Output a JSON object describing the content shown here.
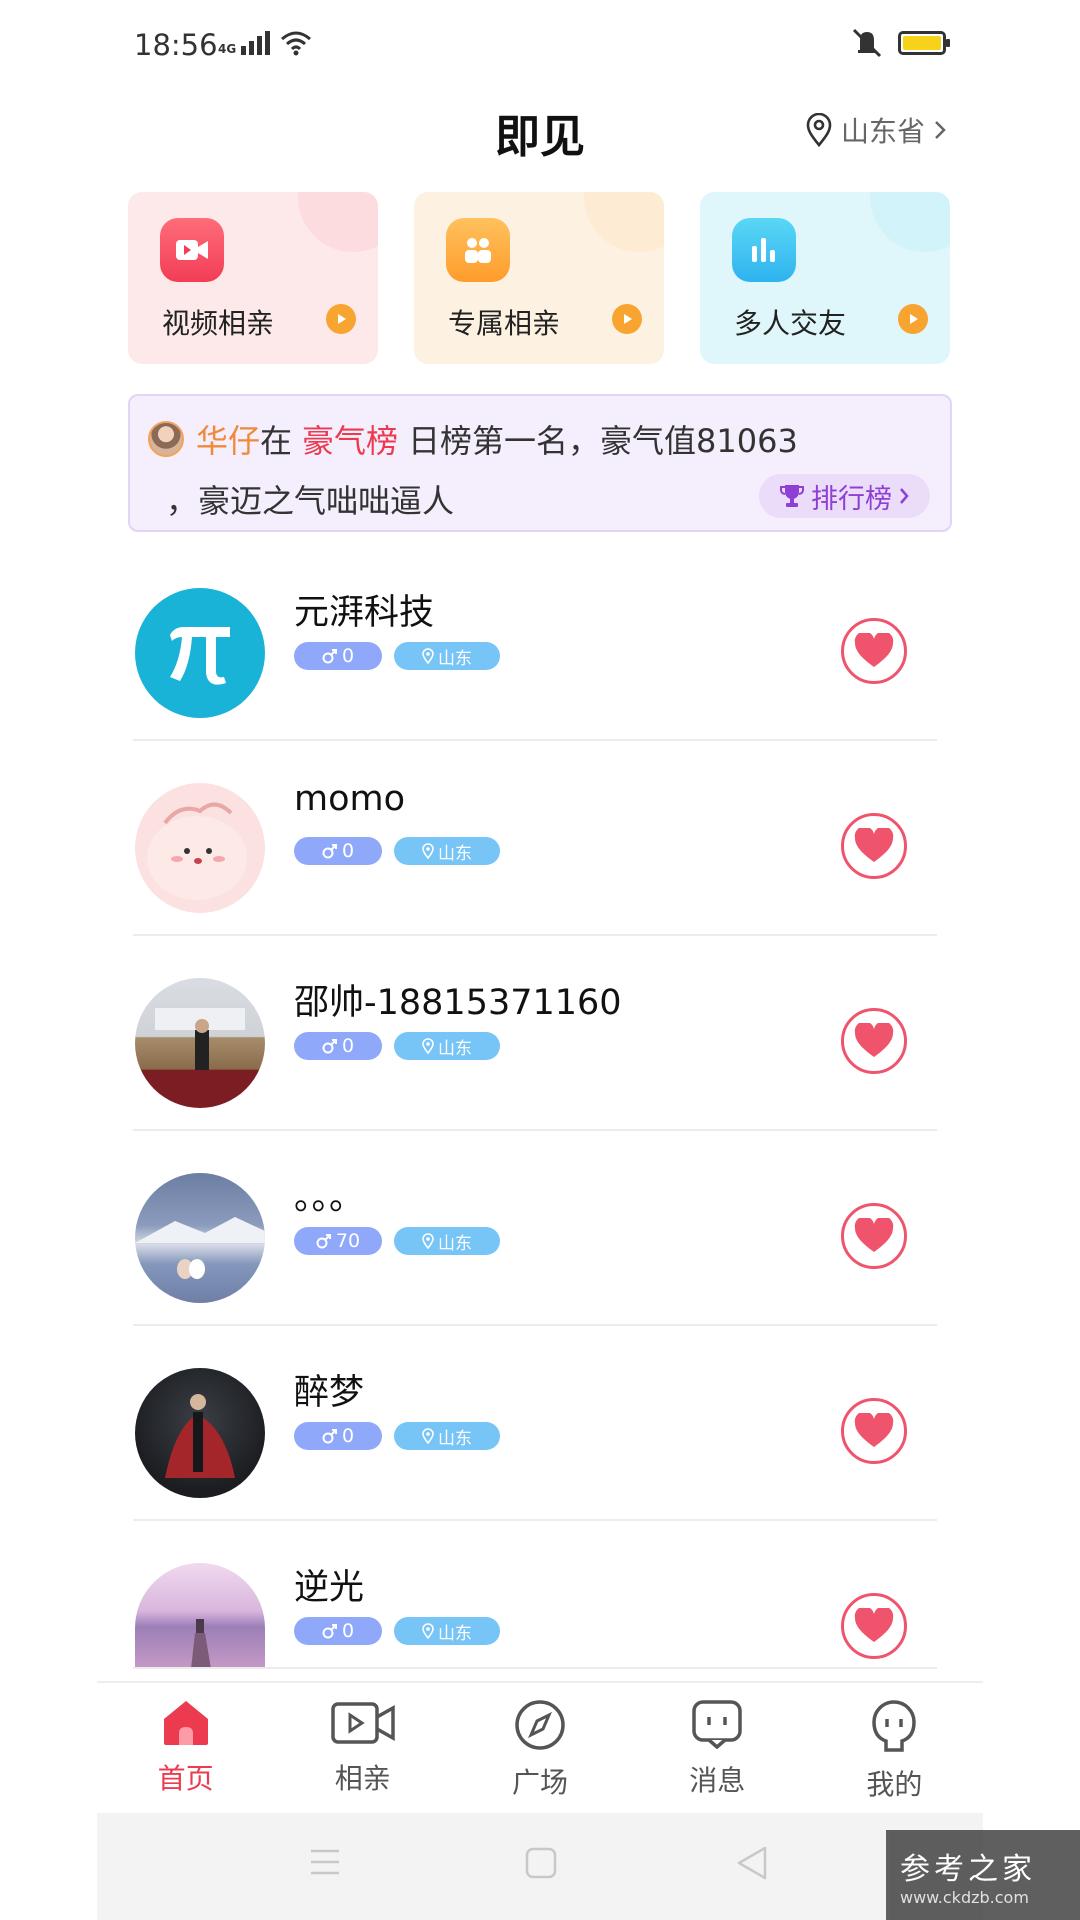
{
  "status_bar": {
    "time": "18:56",
    "network": "4G"
  },
  "header": {
    "title": "即见",
    "location": "山东省"
  },
  "feature_cards": [
    {
      "label": "视频相亲",
      "icon": "video-camera-icon",
      "color": "#f23d57"
    },
    {
      "label": "专属相亲",
      "icon": "people-icon",
      "color": "#ff9c2b"
    },
    {
      "label": "多人交友",
      "icon": "bar-chart-icon",
      "color": "#2fb3ef"
    }
  ],
  "notice": {
    "user": "华仔",
    "in": "在",
    "board": "豪气榜",
    "text": "日榜第一名，豪气值81063",
    "line2": "，豪迈之气咄咄逼人",
    "rank_button": "排行榜"
  },
  "users": [
    {
      "name": "元湃科技",
      "gender_value": "0",
      "location": "山东"
    },
    {
      "name": "momo",
      "gender_value": "0",
      "location": "山东"
    },
    {
      "name": "邵帅-18815371160",
      "gender_value": "0",
      "location": "山东"
    },
    {
      "name": "。。。",
      "gender_value": "70",
      "location": "山东"
    },
    {
      "name": "醉梦",
      "gender_value": "0",
      "location": "山东"
    },
    {
      "name": "逆光",
      "gender_value": "0",
      "location": "山东"
    }
  ],
  "tabs": [
    {
      "label": "首页",
      "icon": "home-icon",
      "active": true
    },
    {
      "label": "相亲",
      "icon": "video-icon",
      "active": false
    },
    {
      "label": "广场",
      "icon": "compass-icon",
      "active": false
    },
    {
      "label": "消息",
      "icon": "message-icon",
      "active": false
    },
    {
      "label": "我的",
      "icon": "profile-icon",
      "active": false
    }
  ],
  "colors": {
    "accent": "#ec3b4f",
    "heart": "#f0546c"
  },
  "watermark": {
    "brand": "参考之家",
    "url": "www.ckdzb.com"
  }
}
